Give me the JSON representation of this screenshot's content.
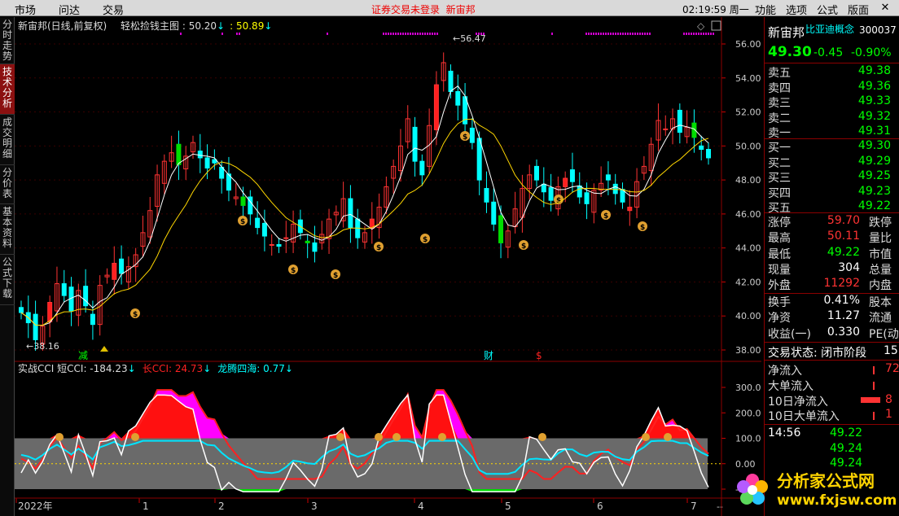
{
  "topbar": {
    "menu": [
      "市场",
      "问达",
      "交易"
    ],
    "notice": "证券交易未登录",
    "stock": "新宙邦",
    "time": "02:19:59 周一",
    "menu_right": [
      "功能",
      "选项",
      "公式",
      "版面"
    ]
  },
  "sidetabs": [
    "分时走势",
    "技术分析",
    "成交明细",
    "分价表",
    "基本资料",
    "公式下载"
  ],
  "main_chart": {
    "title": "新宙邦(日线,前复权)",
    "indicator": "轻松捡钱主图",
    "value1": "50.20",
    "value2": "50.89",
    "price_labels": [
      "56.00",
      "54.00",
      "52.00",
      "50.00",
      "48.00",
      "46.00",
      "44.00",
      "42.00",
      "40.00",
      "38.00"
    ],
    "high_mark": "56.47",
    "low_mark": "38.16",
    "markers": [
      "减",
      "财",
      "$"
    ]
  },
  "sub_chart": {
    "title": "实战CCI",
    "short_label": "短CCI: -184.23",
    "long_label": "长CCI: 24.73",
    "dragon_label": "龙腾四海: 0.77",
    "levels": [
      "300.0",
      "200.0",
      "100.0",
      "0.00",
      "-100.0"
    ]
  },
  "xaxis": {
    "labels": [
      "2022年",
      "1",
      "2",
      "3",
      "4",
      "5",
      "6",
      "7"
    ]
  },
  "quote": {
    "name": "新宙邦",
    "concept": "比亚迪概念",
    "code": "300037",
    "price": "49.30",
    "change": "-0.45",
    "pct": "-0.90%",
    "asks": [
      {
        "label": "卖五",
        "price": "49.38"
      },
      {
        "label": "卖四",
        "price": "49.36"
      },
      {
        "label": "卖三",
        "price": "49.33"
      },
      {
        "label": "卖二",
        "price": "49.32"
      },
      {
        "label": "卖一",
        "price": "49.31"
      }
    ],
    "bids": [
      {
        "label": "买一",
        "price": "49.30"
      },
      {
        "label": "买二",
        "price": "49.29"
      },
      {
        "label": "买三",
        "price": "49.25"
      },
      {
        "label": "买四",
        "price": "49.23"
      },
      {
        "label": "买五",
        "price": "49.22"
      }
    ],
    "stats": [
      {
        "label": "涨停",
        "value": "59.70",
        "right": "跌停"
      },
      {
        "label": "最高",
        "value": "50.11",
        "right": "量比"
      },
      {
        "label": "最低",
        "value": "49.22",
        "right": "市值"
      },
      {
        "label": "现量",
        "value": "304",
        "right": "总量"
      },
      {
        "label": "外盘",
        "value": "11292",
        "right": "内盘"
      }
    ],
    "stats2": [
      {
        "label": "换手",
        "value": "0.41%",
        "right": "股本"
      },
      {
        "label": "净资",
        "value": "11.27",
        "right": "流通"
      },
      {
        "label": "收益(一)",
        "value": "0.330",
        "right": "PE(动"
      }
    ],
    "status": "交易状态: 闭市阶段",
    "status_right": "15",
    "flows": [
      {
        "label": "净流入",
        "value": "72"
      },
      {
        "label": "大单流入",
        "value": ""
      },
      {
        "label": "10日净流入",
        "value": "8"
      },
      {
        "label": "10日大单流入",
        "value": "1"
      }
    ],
    "ticks": [
      {
        "time": "14:56",
        "price": "49.22"
      },
      {
        "time": "",
        "price": "49.24"
      },
      {
        "time": "",
        "price": "49.24"
      }
    ]
  },
  "logo": {
    "text": "分析家公式网",
    "url": "www.fxjsw.com"
  },
  "colors": {
    "up": "#ff3333",
    "down": "#00ffff",
    "ma5": "#ffffff",
    "ma10": "#ffd700",
    "cci_long": "#ff2020",
    "cci_dragon": "#00e5ff",
    "magenta": "#ff00ff"
  }
}
